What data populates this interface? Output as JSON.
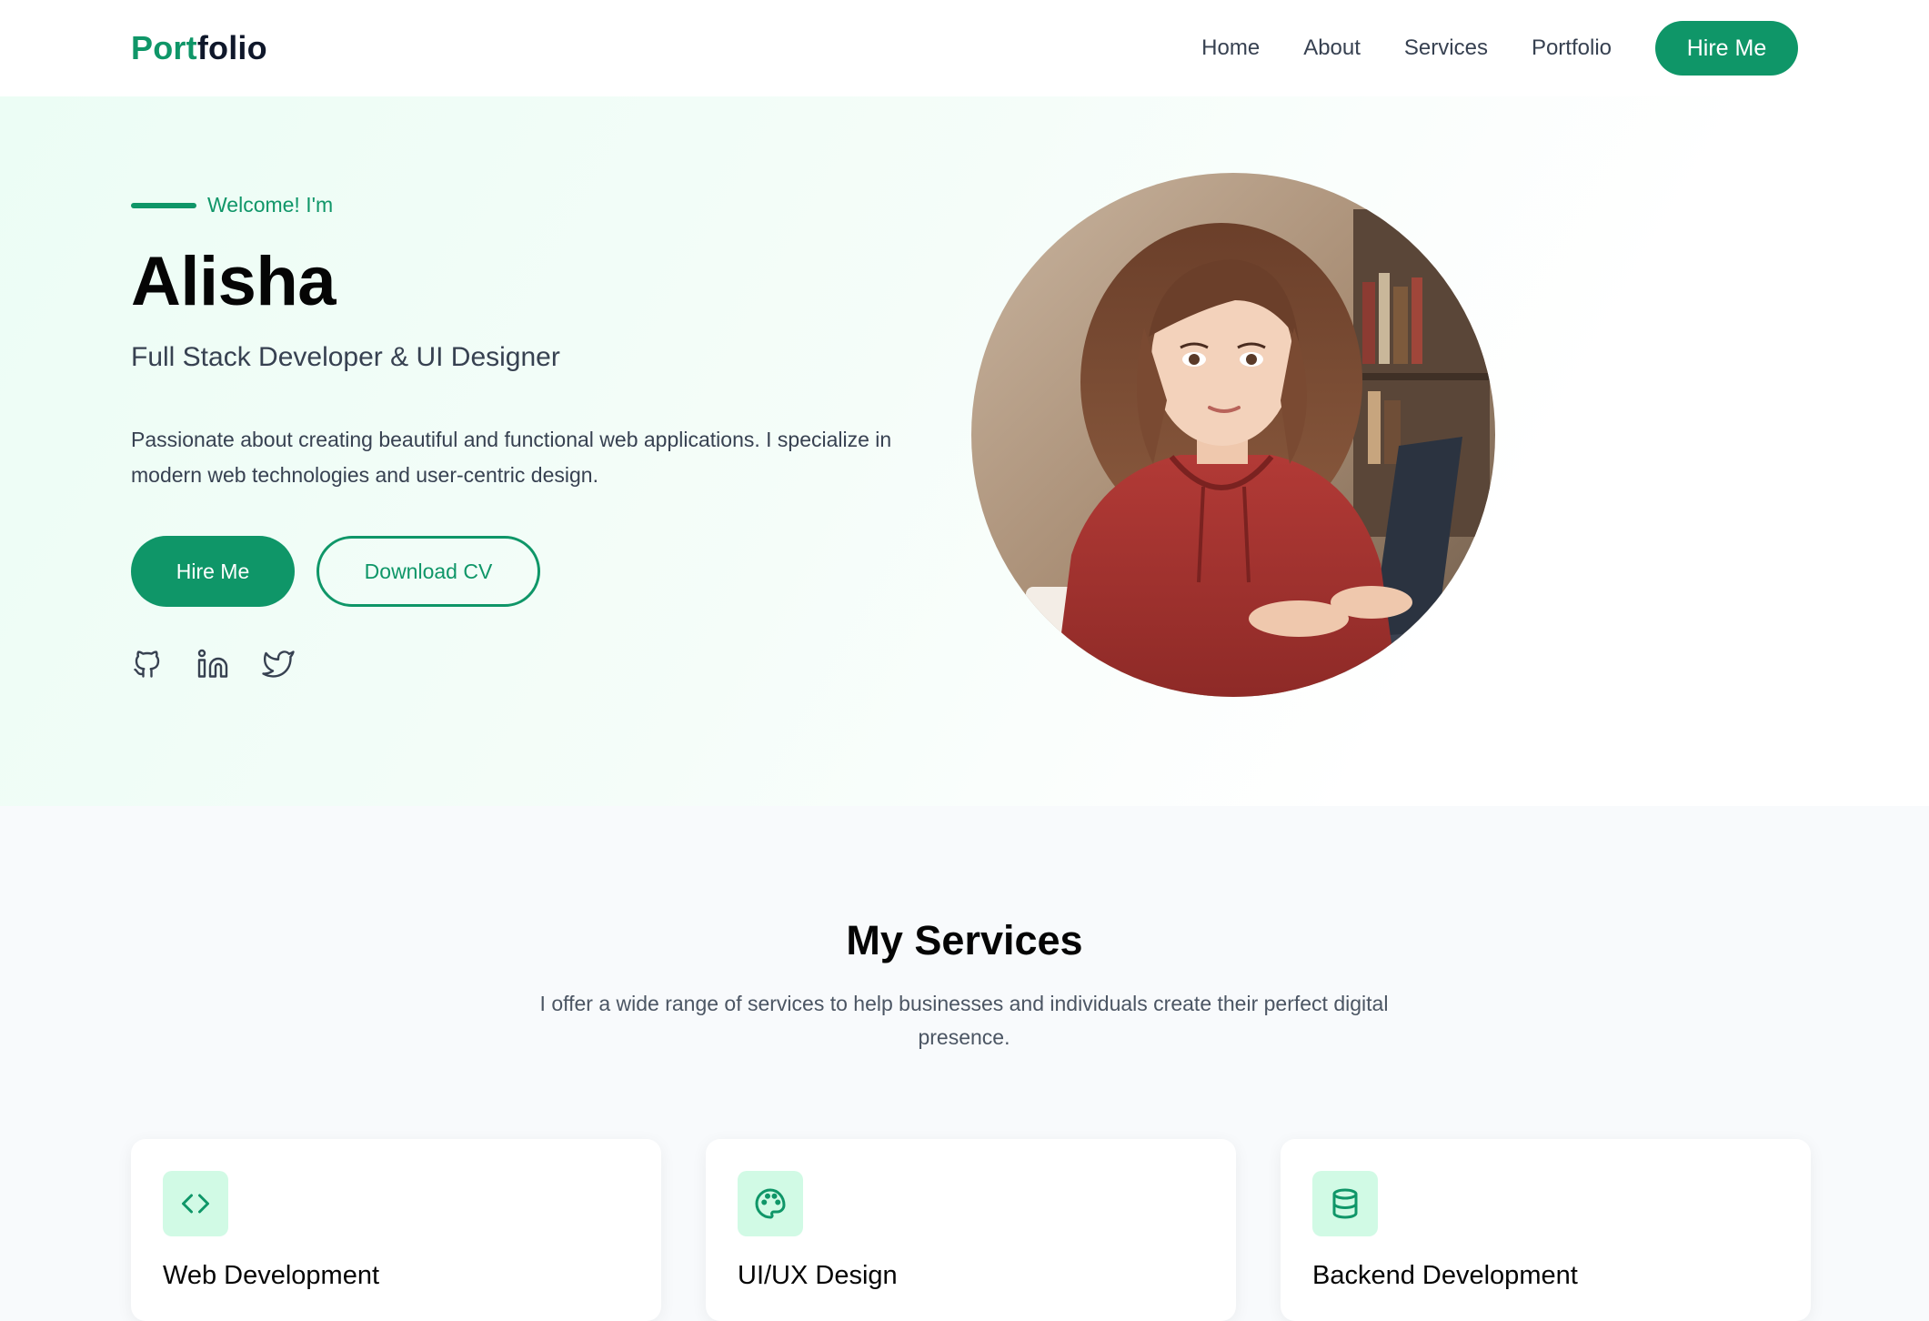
{
  "brand": {
    "logo_accent": "Port",
    "logo_rest": "folio",
    "accent_color": "#0f9668"
  },
  "nav": {
    "links": [
      "Home",
      "About",
      "Services",
      "Portfolio"
    ],
    "cta": "Hire Me"
  },
  "hero": {
    "eyebrow": "Welcome! I'm",
    "name": "Alisha",
    "role": "Full Stack Developer & UI Designer",
    "description": "Passionate about creating beautiful and functional web applications. I specialize in modern web technologies and user-centric design.",
    "primary_button": "Hire Me",
    "secondary_button": "Download CV",
    "social_icons": [
      "github-icon",
      "linkedin-icon",
      "twitter-icon"
    ]
  },
  "services": {
    "title": "My Services",
    "subtitle": "I offer a wide range of services to help businesses and individuals create their perfect digital presence.",
    "cards": [
      {
        "title": "Web Development",
        "icon": "code-icon"
      },
      {
        "title": "UI/UX Design",
        "icon": "palette-icon"
      },
      {
        "title": "Backend Development",
        "icon": "database-icon"
      }
    ]
  }
}
